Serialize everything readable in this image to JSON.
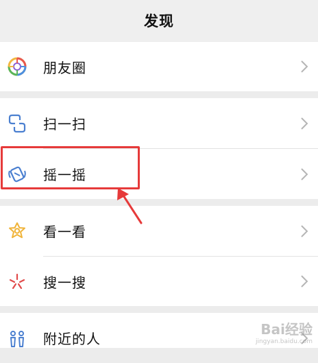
{
  "header": {
    "title": "发现"
  },
  "items": [
    {
      "label": "朋友圈",
      "icon": "moments-icon"
    },
    {
      "label": "扫一扫",
      "icon": "scan-icon"
    },
    {
      "label": "摇一摇",
      "icon": "shake-icon"
    },
    {
      "label": "看一看",
      "icon": "top-stories-icon"
    },
    {
      "label": "搜一搜",
      "icon": "search-icon"
    },
    {
      "label": "附近的人",
      "icon": "people-nearby-icon"
    }
  ],
  "colors": {
    "highlight": "#e63a3a",
    "background": "#ececec",
    "cell": "#ffffff",
    "chevron": "#b5b5b5"
  },
  "watermark": {
    "main": "Bai经验",
    "sub": "jingyan.baidu.com"
  }
}
